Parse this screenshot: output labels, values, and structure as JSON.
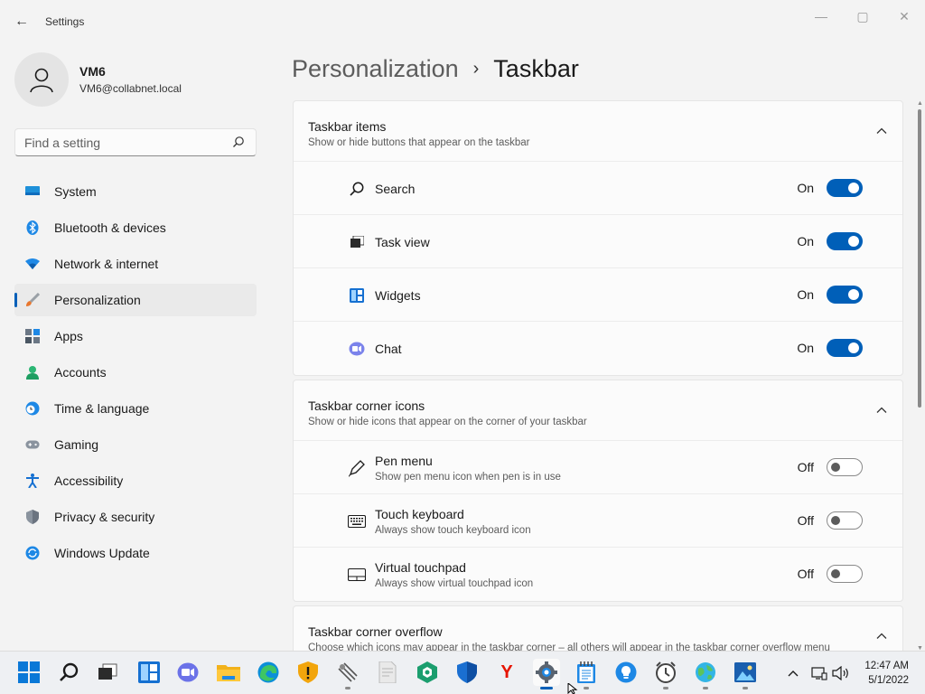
{
  "window": {
    "title": "Settings",
    "back_glyph": "←",
    "minimize_glyph": "—",
    "maximize_glyph": "▢",
    "close_glyph": "✕"
  },
  "profile": {
    "name": "VM6",
    "email": "VM6@collabnet.local"
  },
  "search": {
    "placeholder": "Find a setting"
  },
  "sidebar": {
    "items": [
      {
        "label": "System",
        "icon": "system-icon"
      },
      {
        "label": "Bluetooth & devices",
        "icon": "bluetooth-icon"
      },
      {
        "label": "Network & internet",
        "icon": "wifi-icon"
      },
      {
        "label": "Personalization",
        "icon": "brush-icon",
        "active": true
      },
      {
        "label": "Apps",
        "icon": "apps-icon"
      },
      {
        "label": "Accounts",
        "icon": "accounts-icon"
      },
      {
        "label": "Time & language",
        "icon": "clock-globe-icon"
      },
      {
        "label": "Gaming",
        "icon": "gamepad-icon"
      },
      {
        "label": "Accessibility",
        "icon": "accessibility-icon"
      },
      {
        "label": "Privacy & security",
        "icon": "shield-icon"
      },
      {
        "label": "Windows Update",
        "icon": "update-icon"
      }
    ]
  },
  "breadcrumb": {
    "parent": "Personalization",
    "separator": "›",
    "current": "Taskbar"
  },
  "sections": [
    {
      "title": "Taskbar items",
      "desc": "Show or hide buttons that appear on the taskbar",
      "rows": [
        {
          "label": "Search",
          "state": "On",
          "on": true,
          "icon": "search-icon"
        },
        {
          "label": "Task view",
          "state": "On",
          "on": true,
          "icon": "task-view-icon"
        },
        {
          "label": "Widgets",
          "state": "On",
          "on": true,
          "icon": "widgets-icon"
        },
        {
          "label": "Chat",
          "state": "On",
          "on": true,
          "icon": "chat-icon"
        }
      ]
    },
    {
      "title": "Taskbar corner icons",
      "desc": "Show or hide icons that appear on the corner of your taskbar",
      "rows": [
        {
          "label": "Pen menu",
          "desc": "Show pen menu icon when pen is in use",
          "state": "Off",
          "on": false,
          "icon": "pen-icon"
        },
        {
          "label": "Touch keyboard",
          "desc": "Always show touch keyboard icon",
          "state": "Off",
          "on": false,
          "icon": "keyboard-icon"
        },
        {
          "label": "Virtual touchpad",
          "desc": "Always show virtual touchpad icon",
          "state": "Off",
          "on": false,
          "icon": "touchpad-icon"
        }
      ]
    },
    {
      "title": "Taskbar corner overflow",
      "desc": "Choose which icons may appear in the taskbar corner – all others will appear in the taskbar corner overflow menu"
    }
  ],
  "taskbar": {
    "apps": [
      "start-icon",
      "search-icon",
      "task-view-icon",
      "widgets-icon",
      "chat-icon",
      "file-explorer-icon",
      "edge-icon",
      "security-warning-icon",
      "app-icon",
      "document-icon",
      "green-app-icon",
      "defender-icon",
      "yandex-icon",
      "settings-icon",
      "notepad-icon",
      "bulb-icon",
      "alarm-clock-icon",
      "globe-icon",
      "photos-icon"
    ],
    "yandex_letter": "Y",
    "time": "12:47 AM",
    "date": "5/1/2022"
  },
  "colors": {
    "accent": "#005fb8",
    "background": "#f3f3f3",
    "card": "#fbfbfb"
  }
}
